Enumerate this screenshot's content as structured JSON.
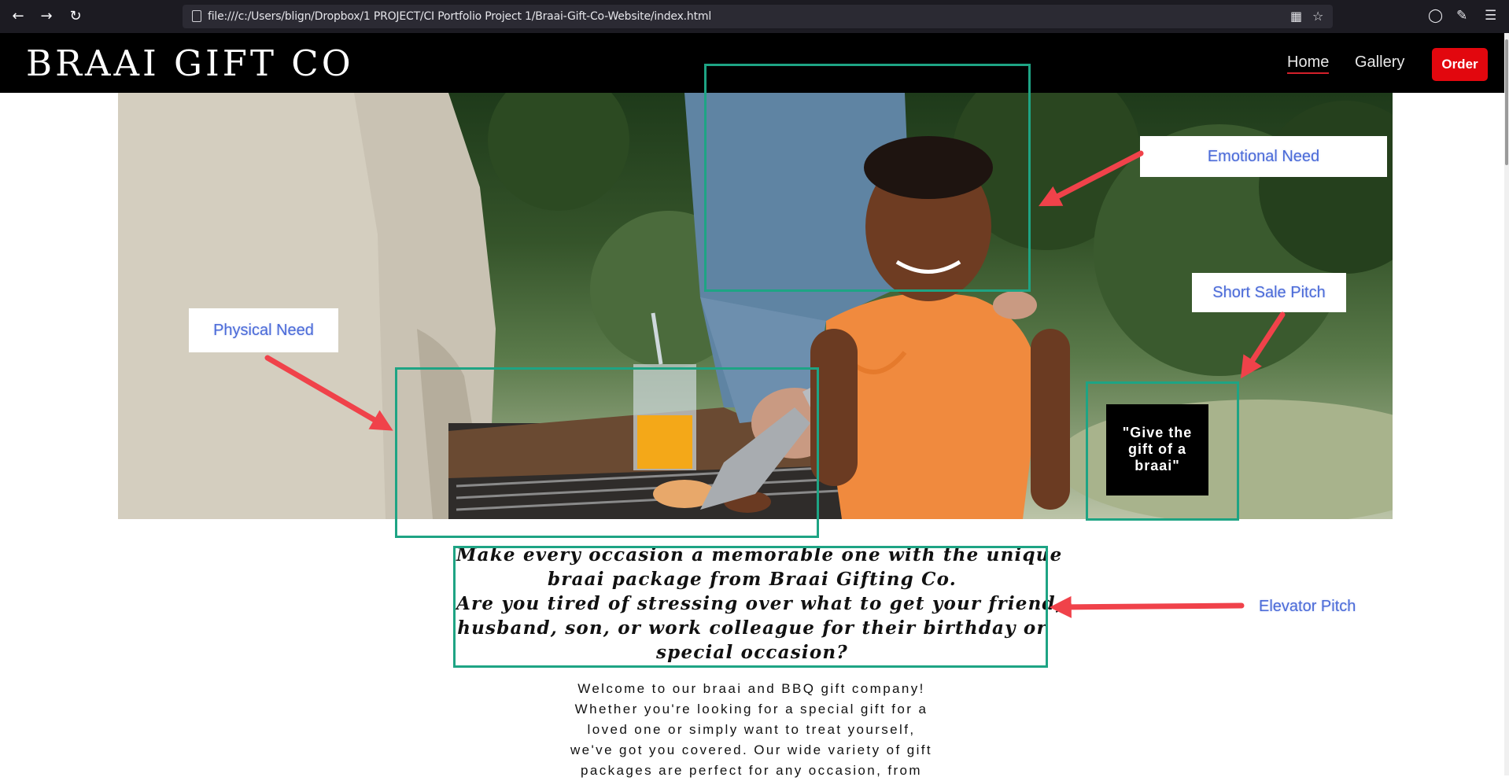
{
  "browser": {
    "back_icon": "arrow-left-icon",
    "forward_icon": "arrow-right-icon",
    "reload_icon": "reload-icon",
    "url": "file:///c:/Users/blign/Dropbox/1 PROJECT/CI Portfolio Project 1/Braai-Gift-Co-Website/index.html"
  },
  "site": {
    "logo": "BRAAI GIFT CO",
    "nav": {
      "home": "Home",
      "gallery": "Gallery",
      "order": "Order"
    },
    "accent": "#e2070e"
  },
  "hero": {
    "pitch_line1": "\"Give the",
    "pitch_line2": "gift of a",
    "pitch_line3": "braai\""
  },
  "annotations": {
    "emotional_need": "Emotional Need",
    "short_sale_pitch": "Short Sale Pitch",
    "physical_need": "Physical Need",
    "elevator_pitch": "Elevator Pitch",
    "box_color": "#1ea484",
    "arrow_color": "#f0424a"
  },
  "headline": {
    "lines": [
      "Make every occasion a memorable one with the unique",
      "braai package from Braai Gifting Co.",
      "Are you tired of stressing over what to get your friend,",
      "husband, son, or work colleague for their birthday or",
      "special occasion?"
    ]
  },
  "intro": {
    "lines": [
      "Welcome to our braai and BBQ gift company!",
      "Whether you're looking for a special gift for a",
      "loved one or simply want to treat yourself,",
      "we've got you covered. Our wide variety of gift",
      "packages are perfect for any occasion, from"
    ]
  }
}
